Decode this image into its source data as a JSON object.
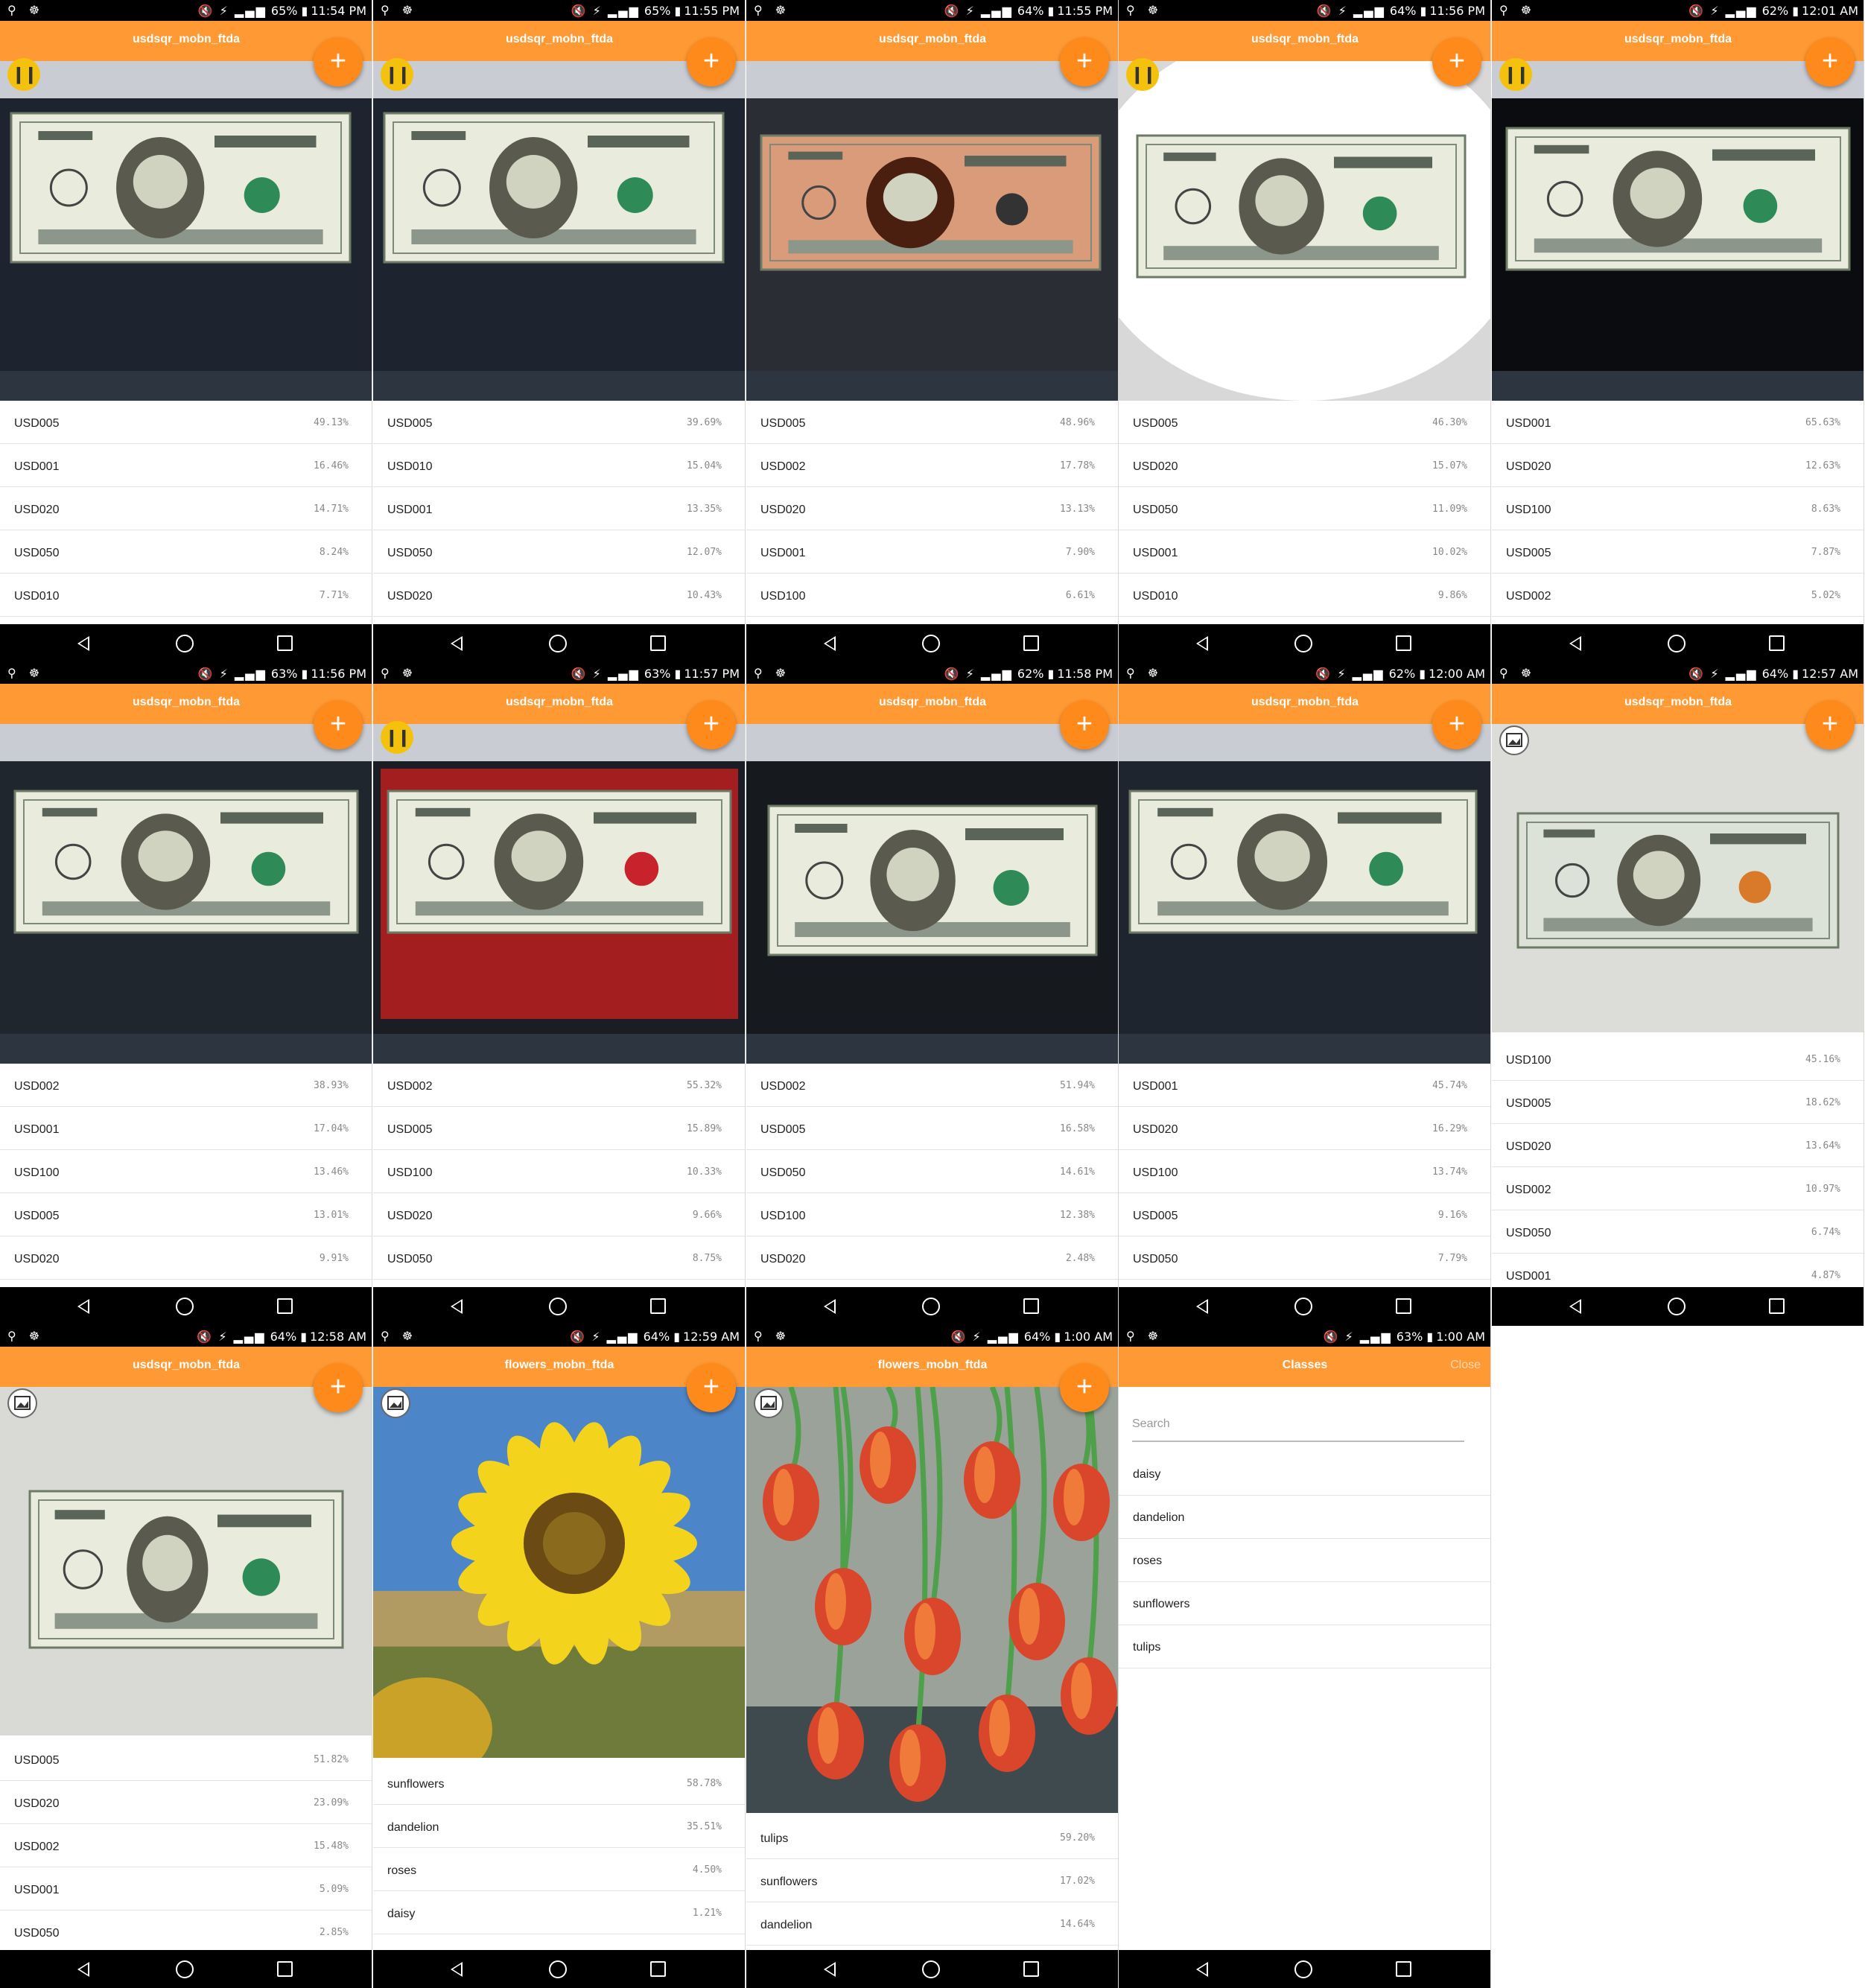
{
  "colors": {
    "appbar": "#ff9933",
    "fab": "#ff8a1c",
    "pause": "#f4c20d",
    "nav": "#000000"
  },
  "icons": {
    "fab": "plus-icon",
    "pause": "pause-icon",
    "gallery": "gallery-icon"
  },
  "panels": [
    {
      "time": "11:54 PM",
      "battery": "65%",
      "title": "usdsqr_mobn_ftda",
      "button": "pause",
      "scene": "usd5",
      "results": [
        {
          "label": "USD005",
          "value": "49.13%"
        },
        {
          "label": "USD001",
          "value": "16.46%"
        },
        {
          "label": "USD020",
          "value": "14.71%"
        },
        {
          "label": "USD050",
          "value": "8.24%"
        },
        {
          "label": "USD010",
          "value": "7.71%"
        }
      ]
    },
    {
      "time": "11:55 PM",
      "battery": "65%",
      "title": "usdsqr_mobn_ftda",
      "button": "pause",
      "scene": "usd5",
      "results": [
        {
          "label": "USD005",
          "value": "39.69%"
        },
        {
          "label": "USD010",
          "value": "15.04%"
        },
        {
          "label": "USD001",
          "value": "13.35%"
        },
        {
          "label": "USD050",
          "value": "12.07%"
        },
        {
          "label": "USD020",
          "value": "10.43%"
        }
      ]
    },
    {
      "time": "11:55 PM",
      "battery": "64%",
      "title": "usdsqr_mobn_ftda",
      "button": "none",
      "scene": "usd5r",
      "results": [
        {
          "label": "USD005",
          "value": "48.96%"
        },
        {
          "label": "USD002",
          "value": "17.78%"
        },
        {
          "label": "USD020",
          "value": "13.13%"
        },
        {
          "label": "USD001",
          "value": "7.90%"
        },
        {
          "label": "USD100",
          "value": "6.61%"
        }
      ]
    },
    {
      "time": "11:56 PM",
      "battery": "64%",
      "title": "usdsqr_mobn_ftda",
      "button": "pause",
      "scene": "usd5w",
      "results": [
        {
          "label": "USD005",
          "value": "46.30%"
        },
        {
          "label": "USD020",
          "value": "15.07%"
        },
        {
          "label": "USD050",
          "value": "11.09%"
        },
        {
          "label": "USD001",
          "value": "10.02%"
        },
        {
          "label": "USD010",
          "value": "9.86%"
        }
      ]
    },
    {
      "time": "12:01 AM",
      "battery": "62%",
      "title": "usdsqr_mobn_ftda",
      "button": "pause",
      "scene": "usd1",
      "results": [
        {
          "label": "USD001",
          "value": "65.63%"
        },
        {
          "label": "USD020",
          "value": "12.63%"
        },
        {
          "label": "USD100",
          "value": "8.63%"
        },
        {
          "label": "USD005",
          "value": "7.87%"
        },
        {
          "label": "USD002",
          "value": "5.02%"
        }
      ]
    },
    {
      "time": "11:56 PM",
      "battery": "63%",
      "title": "usdsqr_mobn_ftda",
      "button": "none",
      "scene": "usd2",
      "results": [
        {
          "label": "USD002",
          "value": "38.93%"
        },
        {
          "label": "USD001",
          "value": "17.04%"
        },
        {
          "label": "USD100",
          "value": "13.46%"
        },
        {
          "label": "USD005",
          "value": "13.01%"
        },
        {
          "label": "USD020",
          "value": "9.91%"
        }
      ]
    },
    {
      "time": "11:57 PM",
      "battery": "63%",
      "title": "usdsqr_mobn_ftda",
      "button": "pause",
      "scene": "usd2r",
      "results": [
        {
          "label": "USD002",
          "value": "55.32%"
        },
        {
          "label": "USD005",
          "value": "15.89%"
        },
        {
          "label": "USD100",
          "value": "10.33%"
        },
        {
          "label": "USD020",
          "value": "9.66%"
        },
        {
          "label": "USD050",
          "value": "8.75%"
        }
      ]
    },
    {
      "time": "11:58 PM",
      "battery": "62%",
      "title": "usdsqr_mobn_ftda",
      "button": "none",
      "scene": "usd2b",
      "results": [
        {
          "label": "USD002",
          "value": "51.94%"
        },
        {
          "label": "USD005",
          "value": "16.58%"
        },
        {
          "label": "USD050",
          "value": "14.61%"
        },
        {
          "label": "USD100",
          "value": "12.38%"
        },
        {
          "label": "USD020",
          "value": "2.48%"
        }
      ]
    },
    {
      "time": "12:00 AM",
      "battery": "62%",
      "title": "usdsqr_mobn_ftda",
      "button": "none",
      "scene": "usd1b",
      "results": [
        {
          "label": "USD001",
          "value": "45.74%"
        },
        {
          "label": "USD020",
          "value": "16.29%"
        },
        {
          "label": "USD100",
          "value": "13.74%"
        },
        {
          "label": "USD005",
          "value": "9.16%"
        },
        {
          "label": "USD050",
          "value": "7.79%"
        }
      ]
    },
    {
      "time": "12:57 AM",
      "battery": "64%",
      "title": "usdsqr_mobn_ftda",
      "button": "gallery",
      "scene": "usd100",
      "results": [
        {
          "label": "USD100",
          "value": "45.16%"
        },
        {
          "label": "USD005",
          "value": "18.62%"
        },
        {
          "label": "USD020",
          "value": "13.64%"
        },
        {
          "label": "USD002",
          "value": "10.97%"
        },
        {
          "label": "USD050",
          "value": "6.74%"
        },
        {
          "label": "USD001",
          "value": "4.87%"
        }
      ]
    },
    {
      "time": "12:58 AM",
      "battery": "64%",
      "title": "usdsqr_mobn_ftda",
      "button": "gallery",
      "scene": "usd5g",
      "results": [
        {
          "label": "USD005",
          "value": "51.82%"
        },
        {
          "label": "USD020",
          "value": "23.09%"
        },
        {
          "label": "USD002",
          "value": "15.48%"
        },
        {
          "label": "USD001",
          "value": "5.09%"
        },
        {
          "label": "USD050",
          "value": "2.85%"
        }
      ]
    },
    {
      "time": "12:59 AM",
      "battery": "64%",
      "title": "flowers_mobn_ftda",
      "button": "gallery",
      "scene": "sunflower",
      "results": [
        {
          "label": "sunflowers",
          "value": "58.78%"
        },
        {
          "label": "dandelion",
          "value": "35.51%"
        },
        {
          "label": "roses",
          "value": "4.50%"
        },
        {
          "label": "daisy",
          "value": "1.21%"
        }
      ]
    },
    {
      "time": "1:00 AM",
      "battery": "64%",
      "title": "flowers_mobn_ftda",
      "button": "gallery",
      "scene": "tulips",
      "results": [
        {
          "label": "tulips",
          "value": "59.20%"
        },
        {
          "label": "sunflowers",
          "value": "17.02%"
        },
        {
          "label": "dandelion",
          "value": "14.64%"
        }
      ]
    }
  ],
  "classes_panel": {
    "time": "1:00 AM",
    "battery": "63%",
    "title": "Classes",
    "close": "Close",
    "search_placeholder": "Search",
    "items": [
      "daisy",
      "dandelion",
      "roses",
      "sunflowers",
      "tulips"
    ]
  }
}
